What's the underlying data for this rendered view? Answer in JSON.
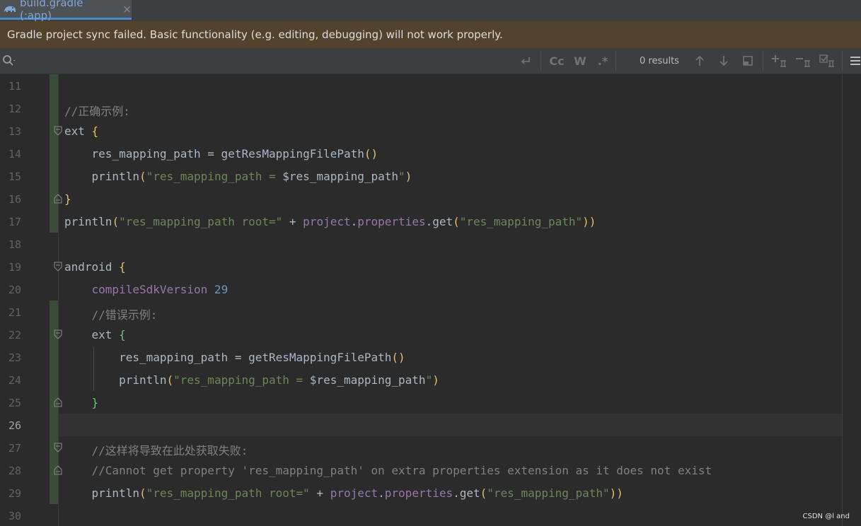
{
  "tab": {
    "title": "build.gradle (:app)",
    "close": "×"
  },
  "banner": {
    "text": "Gradle project sync failed. Basic functionality (e.g. editing, debugging) will not work properly."
  },
  "search": {
    "results": "0 results",
    "toggles": {
      "case": "Cc",
      "words": "W",
      "regex": ".*"
    }
  },
  "watermark": "CSDN @l and",
  "lines": [
    {
      "n": "11"
    },
    {
      "n": "12"
    },
    {
      "n": "13"
    },
    {
      "n": "14"
    },
    {
      "n": "15"
    },
    {
      "n": "16"
    },
    {
      "n": "17"
    },
    {
      "n": "18"
    },
    {
      "n": "19"
    },
    {
      "n": "20"
    },
    {
      "n": "21"
    },
    {
      "n": "22"
    },
    {
      "n": "23"
    },
    {
      "n": "24"
    },
    {
      "n": "25"
    },
    {
      "n": "26"
    },
    {
      "n": "27"
    },
    {
      "n": "28"
    },
    {
      "n": "29"
    },
    {
      "n": "30"
    }
  ],
  "code": {
    "l12": "//正确示例:",
    "l13_a": "ext ",
    "l13_b": "{",
    "l14_a": "    res_mapping_path = getResMappingFilePath",
    "l14_b": "()",
    "l15_a": "    println",
    "l15_b": "(",
    "l15_c": "\"res_mapping_path = ",
    "l15_d": "$res_mapping_path",
    "l15_e": "\"",
    "l15_f": ")",
    "l16": "}",
    "l17_a": "println",
    "l17_b": "(",
    "l17_c": "\"res_mapping_path root=\"",
    "l17_d": " + ",
    "l17_e": "project",
    "l17_f": ".",
    "l17_g": "properties",
    "l17_h": ".get",
    "l17_i": "(",
    "l17_j": "\"res_mapping_path\"",
    "l17_k": "))",
    "l19_a": "android ",
    "l19_b": "{",
    "l20_a": "    compileSdkVersion",
    "l20_b": " 29",
    "l21": "    //错误示例:",
    "l22_a": "    ext ",
    "l22_b": "{",
    "l23_a": "        res_mapping_path = getResMappingFilePath",
    "l23_b": "()",
    "l24_a": "        println",
    "l24_b": "(",
    "l24_c": "\"res_mapping_path = ",
    "l24_d": "$res_mapping_path",
    "l24_e": "\"",
    "l24_f": ")",
    "l25": "    }",
    "l27": "    //这样将导致在此处获取失败:",
    "l28": "    //Cannot get property 'res_mapping_path' on extra properties extension as it does not exist",
    "l29_a": "    println",
    "l29_b": "(",
    "l29_c": "\"res_mapping_path root=\"",
    "l29_d": " + ",
    "l29_e": "project",
    "l29_f": ".",
    "l29_g": "properties",
    "l29_h": ".get",
    "l29_i": "(",
    "l29_j": "\"res_mapping_path\"",
    "l29_k": "))"
  }
}
